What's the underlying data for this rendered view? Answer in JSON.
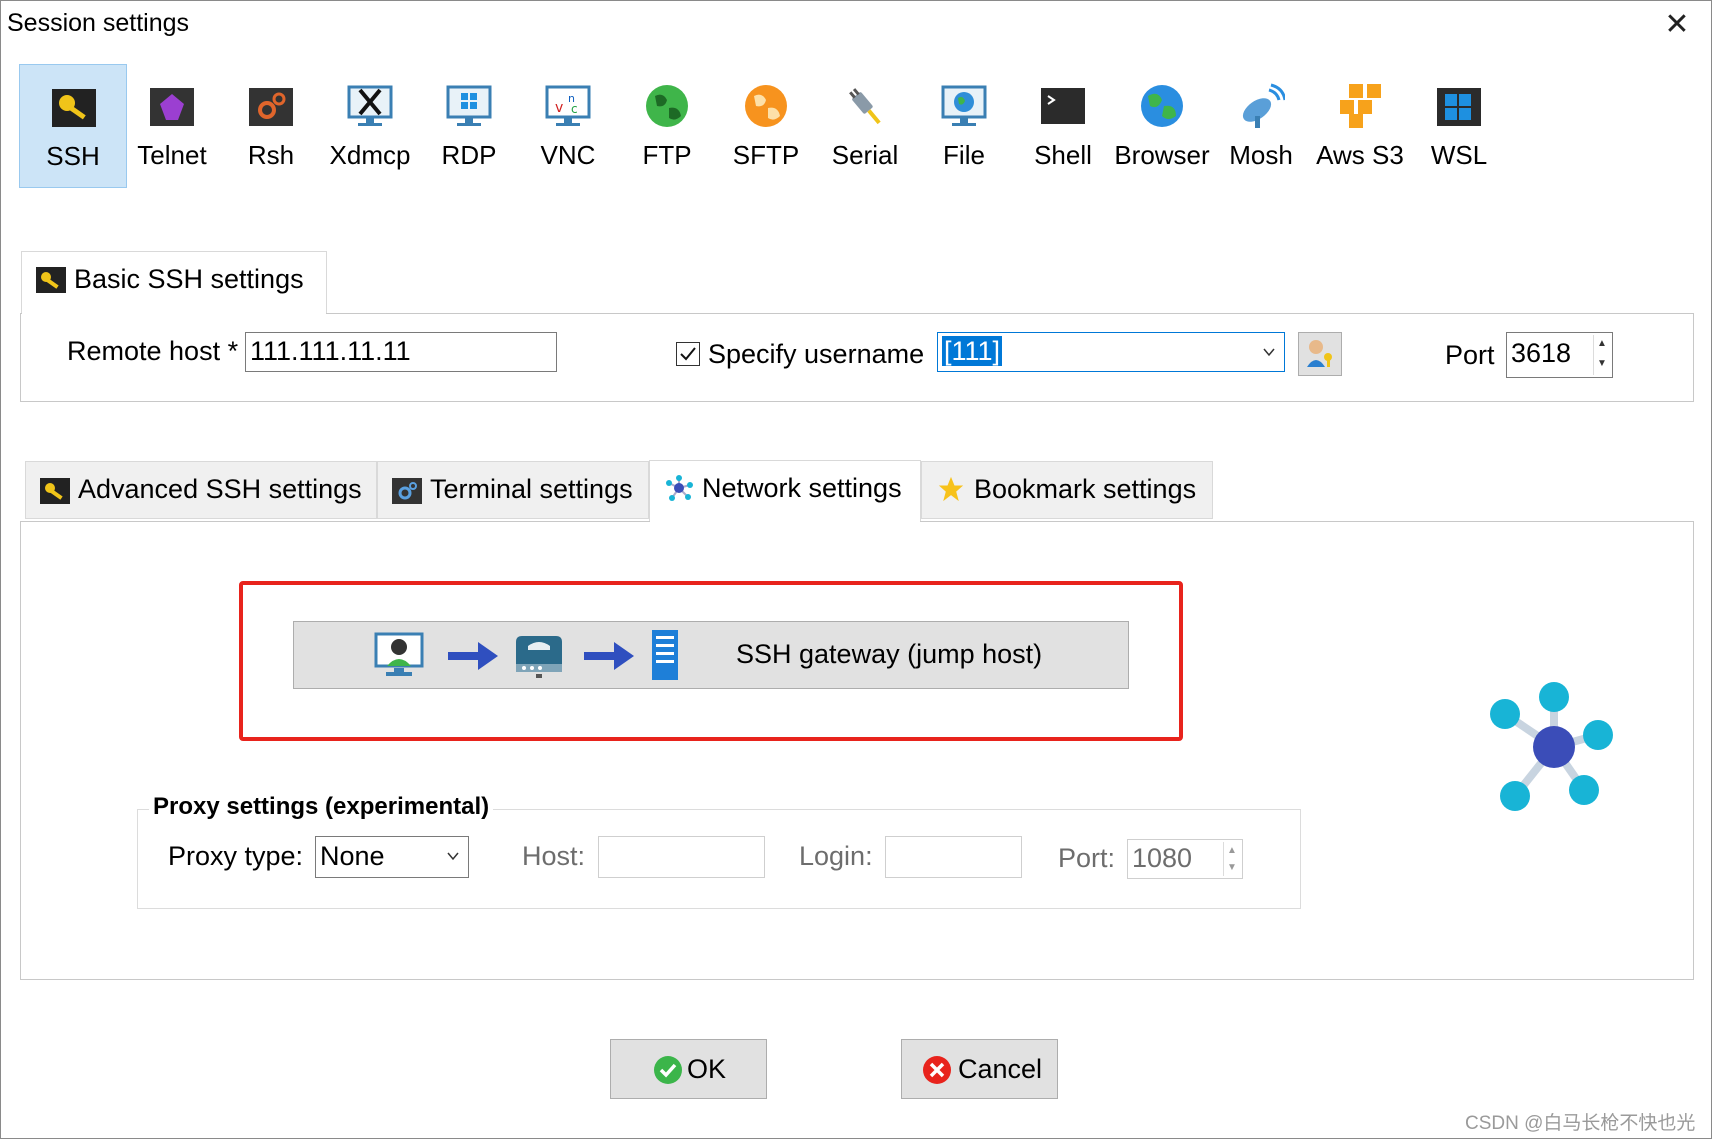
{
  "window": {
    "title": "Session settings"
  },
  "session_types": [
    {
      "label": "SSH",
      "icon": "key-icon",
      "selected": true
    },
    {
      "label": "Telnet",
      "icon": "telnet-gem-icon",
      "selected": false
    },
    {
      "label": "Rsh",
      "icon": "gears-icon",
      "selected": false
    },
    {
      "label": "Xdmcp",
      "icon": "x-monitor-icon",
      "selected": false
    },
    {
      "label": "RDP",
      "icon": "windows-monitor-icon",
      "selected": false
    },
    {
      "label": "VNC",
      "icon": "vnc-monitor-icon",
      "selected": false
    },
    {
      "label": "FTP",
      "icon": "green-globe-icon",
      "selected": false
    },
    {
      "label": "SFTP",
      "icon": "orange-globe-icon",
      "selected": false
    },
    {
      "label": "Serial",
      "icon": "plug-icon",
      "selected": false
    },
    {
      "label": "File",
      "icon": "file-monitor-icon",
      "selected": false
    },
    {
      "label": "Shell",
      "icon": "terminal-icon",
      "selected": false
    },
    {
      "label": "Browser",
      "icon": "browser-globe-icon",
      "selected": false
    },
    {
      "label": "Mosh",
      "icon": "satellite-dish-icon",
      "selected": false
    },
    {
      "label": "Aws S3",
      "icon": "aws-boxes-icon",
      "selected": false
    },
    {
      "label": "WSL",
      "icon": "windows-logo-icon",
      "selected": false
    }
  ],
  "basic": {
    "tab_label": "Basic SSH settings",
    "remote_host_label": "Remote host *",
    "remote_host_value": "111.111.11.11",
    "specify_username_label": "Specify username",
    "specify_username_checked": true,
    "username_value": "[111]",
    "port_label": "Port",
    "port_value": "3618"
  },
  "tabs": [
    {
      "label": "Advanced SSH settings",
      "icon": "key-icon"
    },
    {
      "label": "Terminal settings",
      "icon": "terminal-gear-icon"
    },
    {
      "label": "Network settings",
      "icon": "network-icon",
      "active": true
    },
    {
      "label": "Bookmark settings",
      "icon": "star-icon"
    }
  ],
  "network": {
    "gateway_button_label": "SSH gateway (jump host)",
    "proxy_group_title": "Proxy settings (experimental)",
    "proxy_type_label": "Proxy type:",
    "proxy_type_value": "None",
    "host_label": "Host:",
    "host_value": "",
    "login_label": "Login:",
    "login_value": "",
    "port_label": "Port:",
    "port_value": "1080"
  },
  "buttons": {
    "ok": "OK",
    "cancel": "Cancel"
  },
  "watermark": "CSDN @白马长枪不快也光",
  "colors": {
    "selected_bg": "#cce4f7",
    "highlight": "#0078d7",
    "annotation_red": "#e8231c"
  }
}
